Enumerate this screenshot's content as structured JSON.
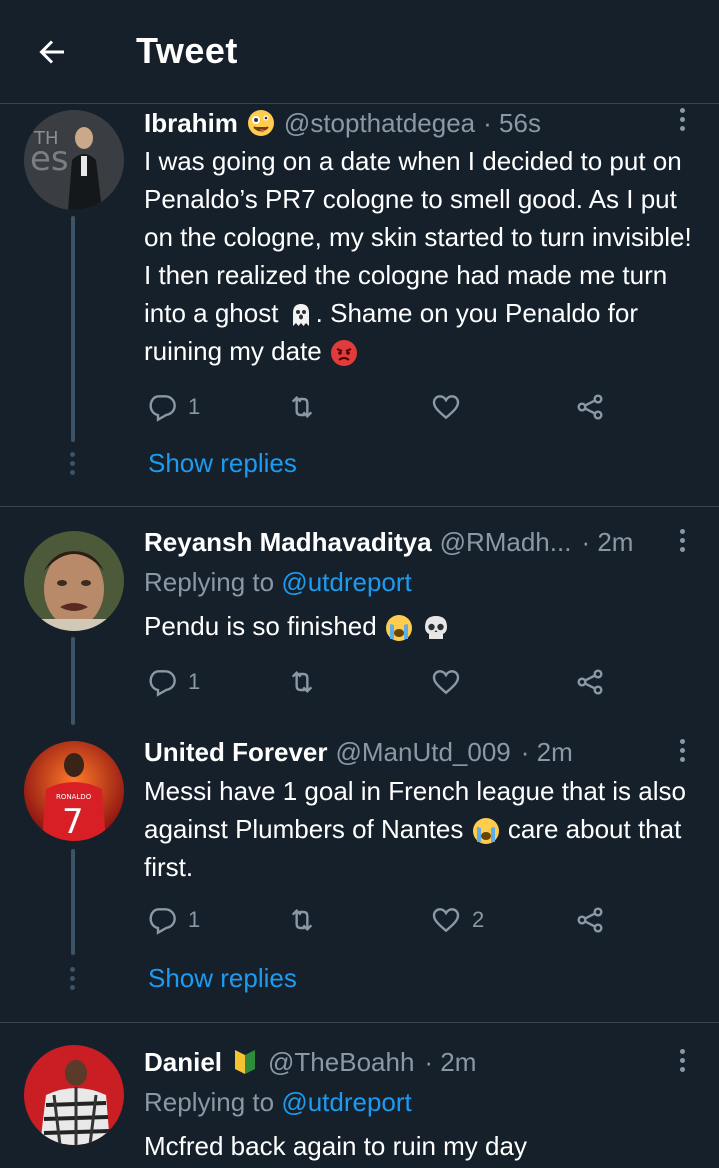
{
  "header": {
    "title": "Tweet"
  },
  "tweets": [
    {
      "name": "Ibrahim",
      "name_emoji": "zany-face-emoji",
      "handle": "@stopthatdegea",
      "time": "· 56s",
      "text_1": "I was going on a date when I decided to put on Penaldo’s PR7 cologne to smell good. As I put on the cologne, my skin started to turn invisible! I then realized the cologne had made me turn into a ghost ",
      "text_2": ". Shame on you Penaldo for ruining my date ",
      "replies": "1",
      "retweets": "",
      "likes": "",
      "show_replies": "Show replies"
    },
    {
      "name": "Reyansh Madhavaditya",
      "handle": "@RMadh...",
      "time": "· 2m",
      "replying_prefix": "Replying to ",
      "replying_to": "@utdreport",
      "text": "Pendu is so finished ",
      "replies": "1",
      "retweets": "",
      "likes": ""
    },
    {
      "name": "United Forever",
      "handle": "@ManUtd_009",
      "time": "· 2m",
      "text_1": "Messi have 1 goal in French league that is also against Plumbers of Nantes ",
      "text_2": " care about that first.",
      "replies": "1",
      "retweets": "",
      "likes": "2",
      "show_replies": "Show replies"
    },
    {
      "name": "Daniel",
      "handle": "@TheBoahh",
      "time": "· 2m",
      "replying_prefix": "Replying to ",
      "replying_to": "@utdreport",
      "text": "Mcfred back again to ruin my day"
    }
  ],
  "colors": {
    "background": "#15202b",
    "divider": "#38444d",
    "secondary_text": "#8b98a5",
    "link": "#1d9bf0"
  }
}
